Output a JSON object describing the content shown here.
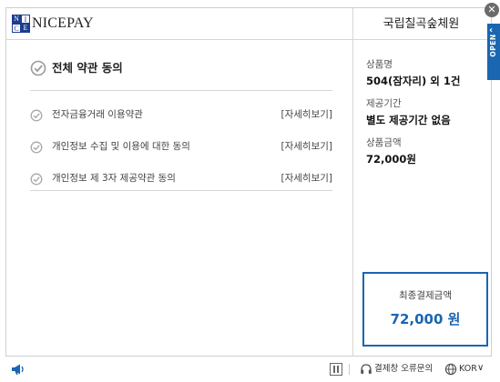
{
  "header": {
    "logo_letters": [
      "N",
      "I",
      "C",
      "E"
    ],
    "logo_text": "NICEPAY",
    "merchant_name": "국립칠곡숲체원"
  },
  "terms": {
    "agree_all_label": "전체 약관 동의",
    "items": [
      {
        "label": "전자금융거래 이용약관",
        "link": "[자세히보기]"
      },
      {
        "label": "개인정보 수집 및 이용에 대한 동의",
        "link": "[자세히보기]"
      },
      {
        "label": "개인정보 제 3자 제공약관 동의",
        "link": "[자세히보기]"
      }
    ]
  },
  "summary": {
    "product_label": "상품명",
    "product_value": "504(잠자리) 외 1건",
    "period_label": "제공기간",
    "period_value": "별도 제공기간 없음",
    "amount_label": "상품금액",
    "amount_value": "72,000원",
    "total_label": "최종결제금액",
    "total_value": "72,000 원"
  },
  "side": {
    "open_label": "OPEN"
  },
  "footer": {
    "report_label": "결제창 오류문의",
    "language": "KOR"
  },
  "colors": {
    "accent": "#1a66b0",
    "brand": "#1c3d8f"
  },
  "icons": {
    "close": "close-icon",
    "check": "check-circle-icon",
    "speaker": "megaphone-icon",
    "layout": "panel-icon",
    "headset": "headset-icon",
    "globe": "globe-icon"
  }
}
